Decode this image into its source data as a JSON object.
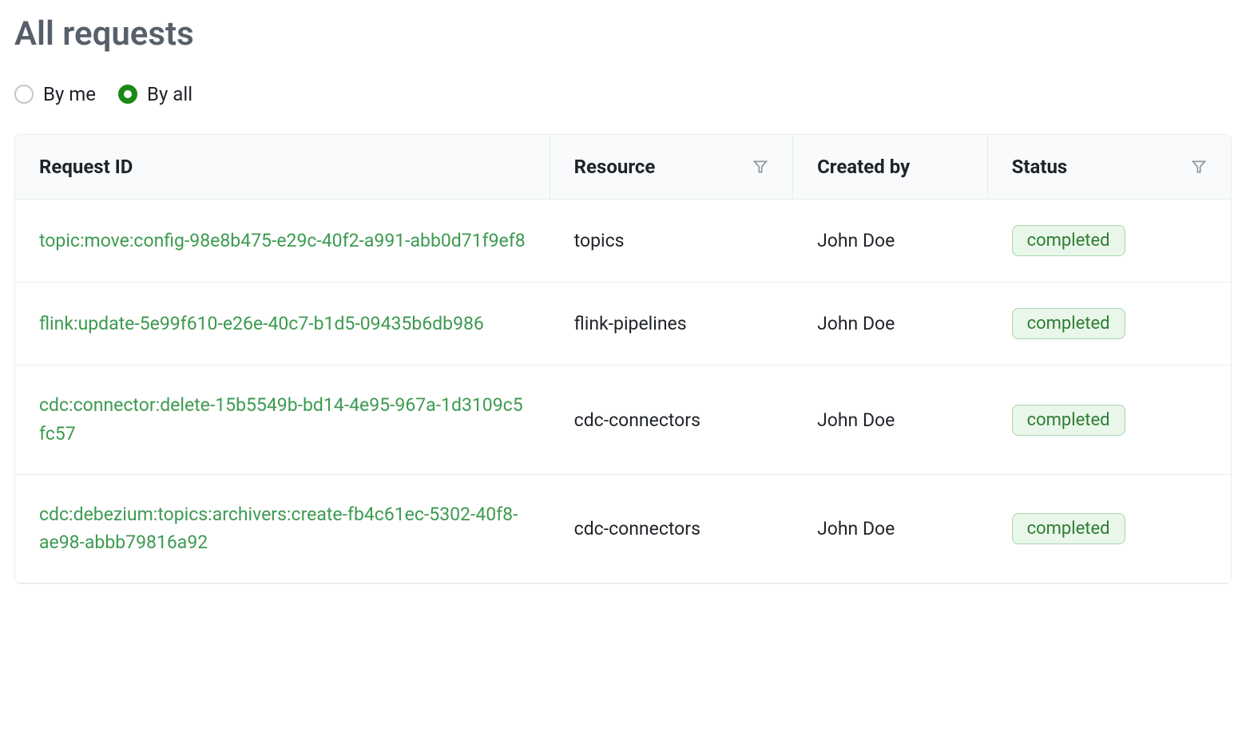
{
  "title": "All requests",
  "filter": {
    "by_me_label": "By me",
    "by_all_label": "By all",
    "selected": "by_all"
  },
  "columns": {
    "request_id": "Request ID",
    "resource": "Resource",
    "created_by": "Created by",
    "status": "Status"
  },
  "rows": [
    {
      "id": "topic:move:config-98e8b475-e29c-40f2-a991-abb0d71f9ef8",
      "resource": "topics",
      "created_by": "John Doe",
      "status": "completed"
    },
    {
      "id": "flink:update-5e99f610-e26e-40c7-b1d5-09435b6db986",
      "resource": "flink-pipelines",
      "created_by": "John Doe",
      "status": "completed"
    },
    {
      "id": "cdc:connector:delete-15b5549b-bd14-4e95-967a-1d3109c5fc57",
      "resource": "cdc-connectors",
      "created_by": "John Doe",
      "status": "completed"
    },
    {
      "id": "cdc:debezium:topics:archivers:create-fb4c61ec-5302-40f8-ae98-abbb79816a92",
      "resource": "cdc-connectors",
      "created_by": "John Doe",
      "status": "completed"
    }
  ]
}
